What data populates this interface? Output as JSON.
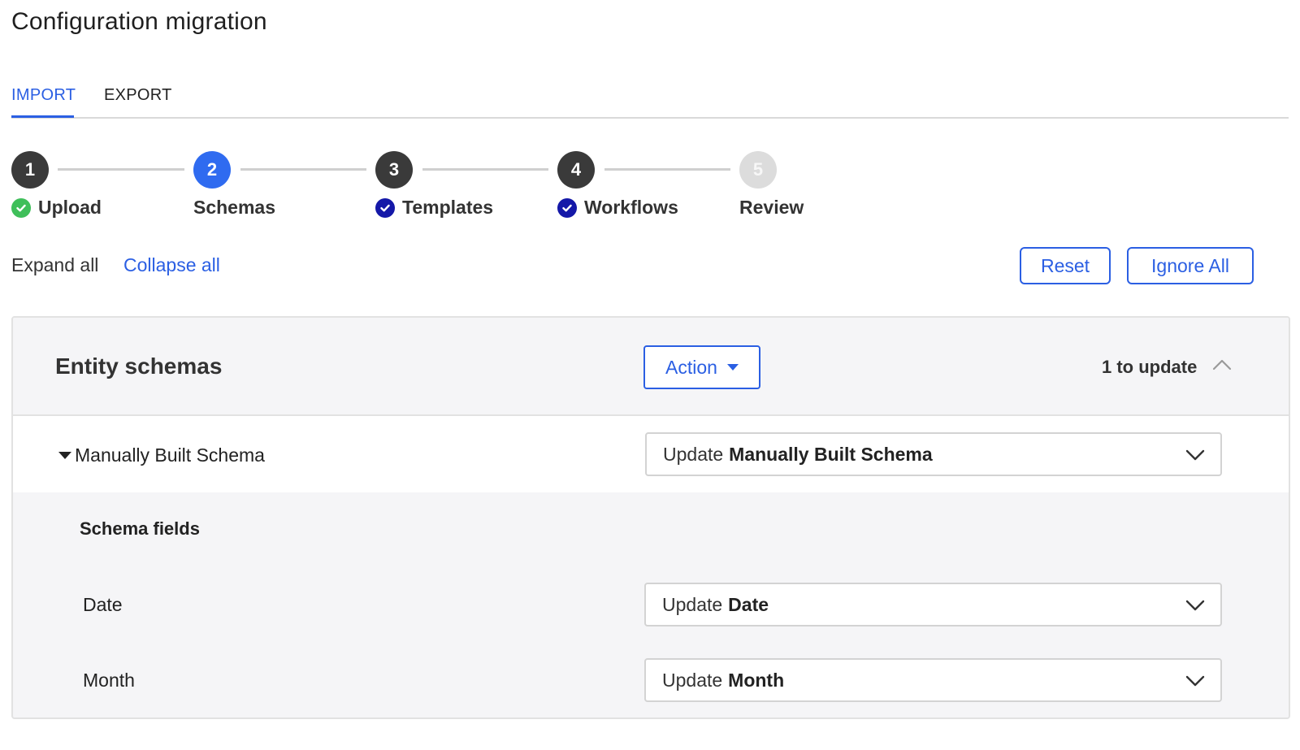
{
  "page": {
    "title": "Configuration migration"
  },
  "tabs": [
    {
      "label": "IMPORT",
      "active": true
    },
    {
      "label": "EXPORT",
      "active": false
    }
  ],
  "stepper": {
    "steps": [
      {
        "number": "1",
        "label": "Upload",
        "state": "done",
        "check": "green-check-icon"
      },
      {
        "number": "2",
        "label": "Schemas",
        "state": "current",
        "check": null
      },
      {
        "number": "3",
        "label": "Templates",
        "state": "done",
        "check": "navy-check-icon"
      },
      {
        "number": "4",
        "label": "Workflows",
        "state": "done",
        "check": "navy-check-icon"
      },
      {
        "number": "5",
        "label": "Review",
        "state": "pending",
        "check": null
      }
    ]
  },
  "controls": {
    "expand_all": "Expand all",
    "collapse_all": "Collapse all",
    "reset": "Reset",
    "ignore_all": "Ignore All"
  },
  "panel": {
    "title": "Entity schemas",
    "action_label": "Action",
    "update_count": "1 to update",
    "schema": {
      "name": "Manually Built Schema",
      "select_prefix": "Update",
      "select_value": "Manually Built Schema"
    },
    "fields_heading": "Schema fields",
    "fields": [
      {
        "name": "Date",
        "select_prefix": "Update",
        "select_value": "Date"
      },
      {
        "name": "Month",
        "select_prefix": "Update",
        "select_value": "Month"
      }
    ]
  },
  "colors": {
    "accent": "#2b5fe3",
    "step_done": "#3a3a3a",
    "step_current": "#2f6bf0",
    "step_pending": "#dcdcdc",
    "check_green": "#3fbf5a",
    "check_navy": "#1418a8",
    "panel_bg": "#f5f5f7"
  }
}
